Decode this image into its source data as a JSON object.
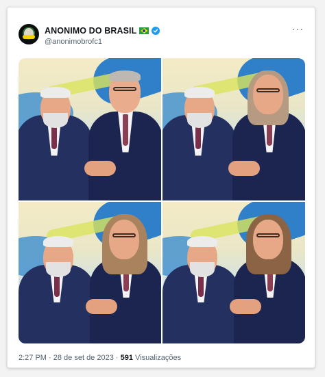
{
  "tweet": {
    "display_name": "ANONIMO DO BRASIL",
    "flag_icon": "brazil-flag-icon",
    "verified_icon": "verified-badge-icon",
    "handle": "@anonimobrofc1",
    "more_label": "···",
    "media": {
      "photo_count": 4
    },
    "footer": {
      "time": "2:27 PM",
      "separator1": " · ",
      "date": "28 de set de 2023",
      "separator2": " · ",
      "views_count": "591",
      "views_label": "Visualizações"
    }
  },
  "colors": {
    "verified": "#1d9bf0",
    "text_primary": "#0f1419",
    "text_secondary": "#536471"
  }
}
